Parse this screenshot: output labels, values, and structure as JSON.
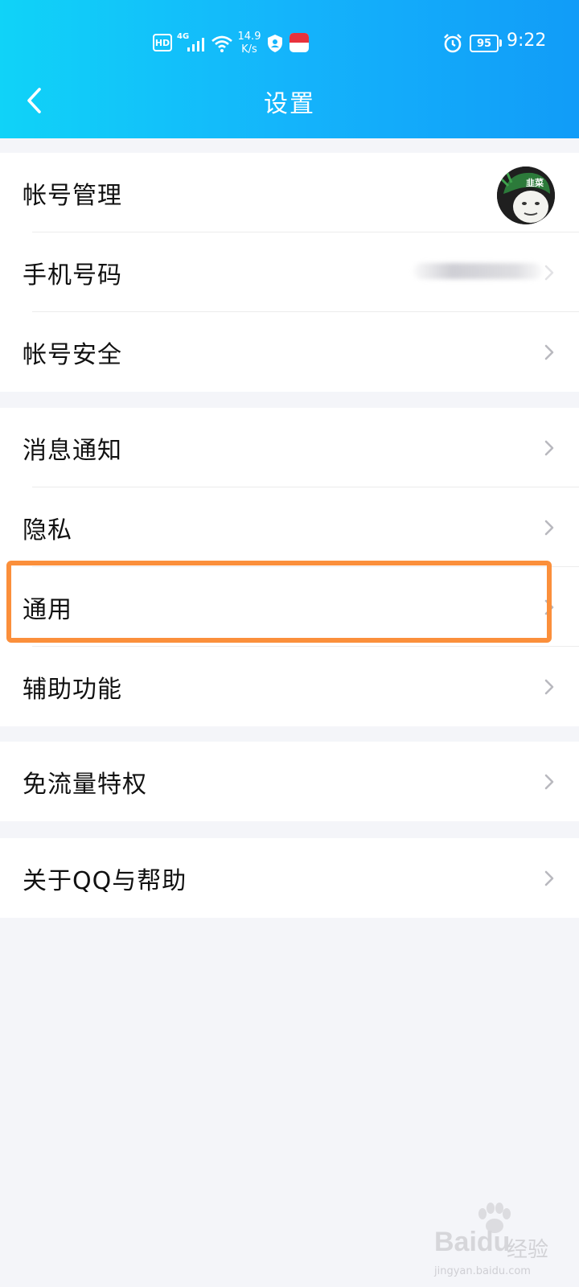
{
  "status_bar": {
    "hd": "HD",
    "network": "4G",
    "speed_value": "14.9",
    "speed_unit": "K/s",
    "battery": "95",
    "time": "9:22"
  },
  "header": {
    "title": "设置"
  },
  "groups": [
    {
      "items": [
        {
          "label": "帐号管理",
          "trailing": "avatar"
        },
        {
          "label": "手机号码",
          "trailing": "blurred-value"
        },
        {
          "label": "帐号安全",
          "trailing": "chevron"
        }
      ]
    },
    {
      "items": [
        {
          "label": "消息通知",
          "trailing": "chevron"
        },
        {
          "label": "隐私",
          "trailing": "chevron"
        },
        {
          "label": "通用",
          "trailing": "chevron",
          "highlighted": true
        },
        {
          "label": "辅助功能",
          "trailing": "chevron"
        }
      ]
    },
    {
      "items": [
        {
          "label": "免流量特权",
          "trailing": "chevron"
        }
      ]
    },
    {
      "items": [
        {
          "label": "关于QQ与帮助",
          "trailing": "chevron"
        }
      ]
    }
  ],
  "avatar_text": "韭菜",
  "watermark": {
    "logo": "Baidu",
    "suffix": "经验",
    "url": "jingyan.baidu.com"
  },
  "colors": {
    "header_start": "#10d3f8",
    "header_end": "#119cf8",
    "highlight_border": "#fb8f3b",
    "background": "#f4f5f9"
  }
}
